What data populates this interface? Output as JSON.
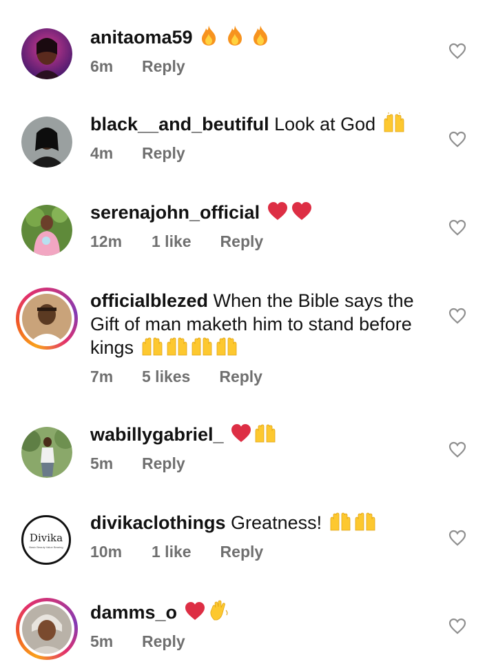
{
  "comments": [
    {
      "username": "anitaoma59",
      "text": "",
      "emojis": [
        "fire",
        "fire",
        "fire"
      ],
      "time": "6m",
      "likes": "",
      "reply": "Reply"
    },
    {
      "username": "black__and_beutiful",
      "text": " Look at God",
      "emojis": [
        "raised-hands"
      ],
      "time": "4m",
      "likes": "",
      "reply": "Reply"
    },
    {
      "username": "serenajohn_official",
      "text": "",
      "emojis": [
        "red-heart",
        "red-heart"
      ],
      "time": "12m",
      "likes": "1 like",
      "reply": "Reply"
    },
    {
      "username": "officialblezed",
      "text": " When the Bible says the Gift of man maketh him to stand before kings",
      "emojis": [
        "raised-hands",
        "raised-hands",
        "raised-hands",
        "raised-hands"
      ],
      "time": "7m",
      "likes": "5 likes",
      "reply": "Reply",
      "story_ring": true
    },
    {
      "username": "wabillygabriel_",
      "text": "",
      "emojis": [
        "red-heart",
        "raised-hands"
      ],
      "time": "5m",
      "likes": "",
      "reply": "Reply"
    },
    {
      "username": "divikaclothings",
      "text": " Greatness!",
      "emojis": [
        "raised-hands",
        "raised-hands"
      ],
      "time": "10m",
      "likes": "1 like",
      "reply": "Reply",
      "logo_text": "Divika",
      "logo_tagline": "Basic Beauty Value Bearing"
    },
    {
      "username": "damms_o",
      "text": "",
      "emojis": [
        "red-heart",
        "waving-hand"
      ],
      "time": "5m",
      "likes": "",
      "reply": "Reply",
      "story_ring": true
    }
  ],
  "colors": {
    "text": "#111111",
    "meta": "#6f6f6f",
    "heart_outline": "#8e8e8e"
  },
  "icons": {
    "like": "heart-outline-icon"
  }
}
